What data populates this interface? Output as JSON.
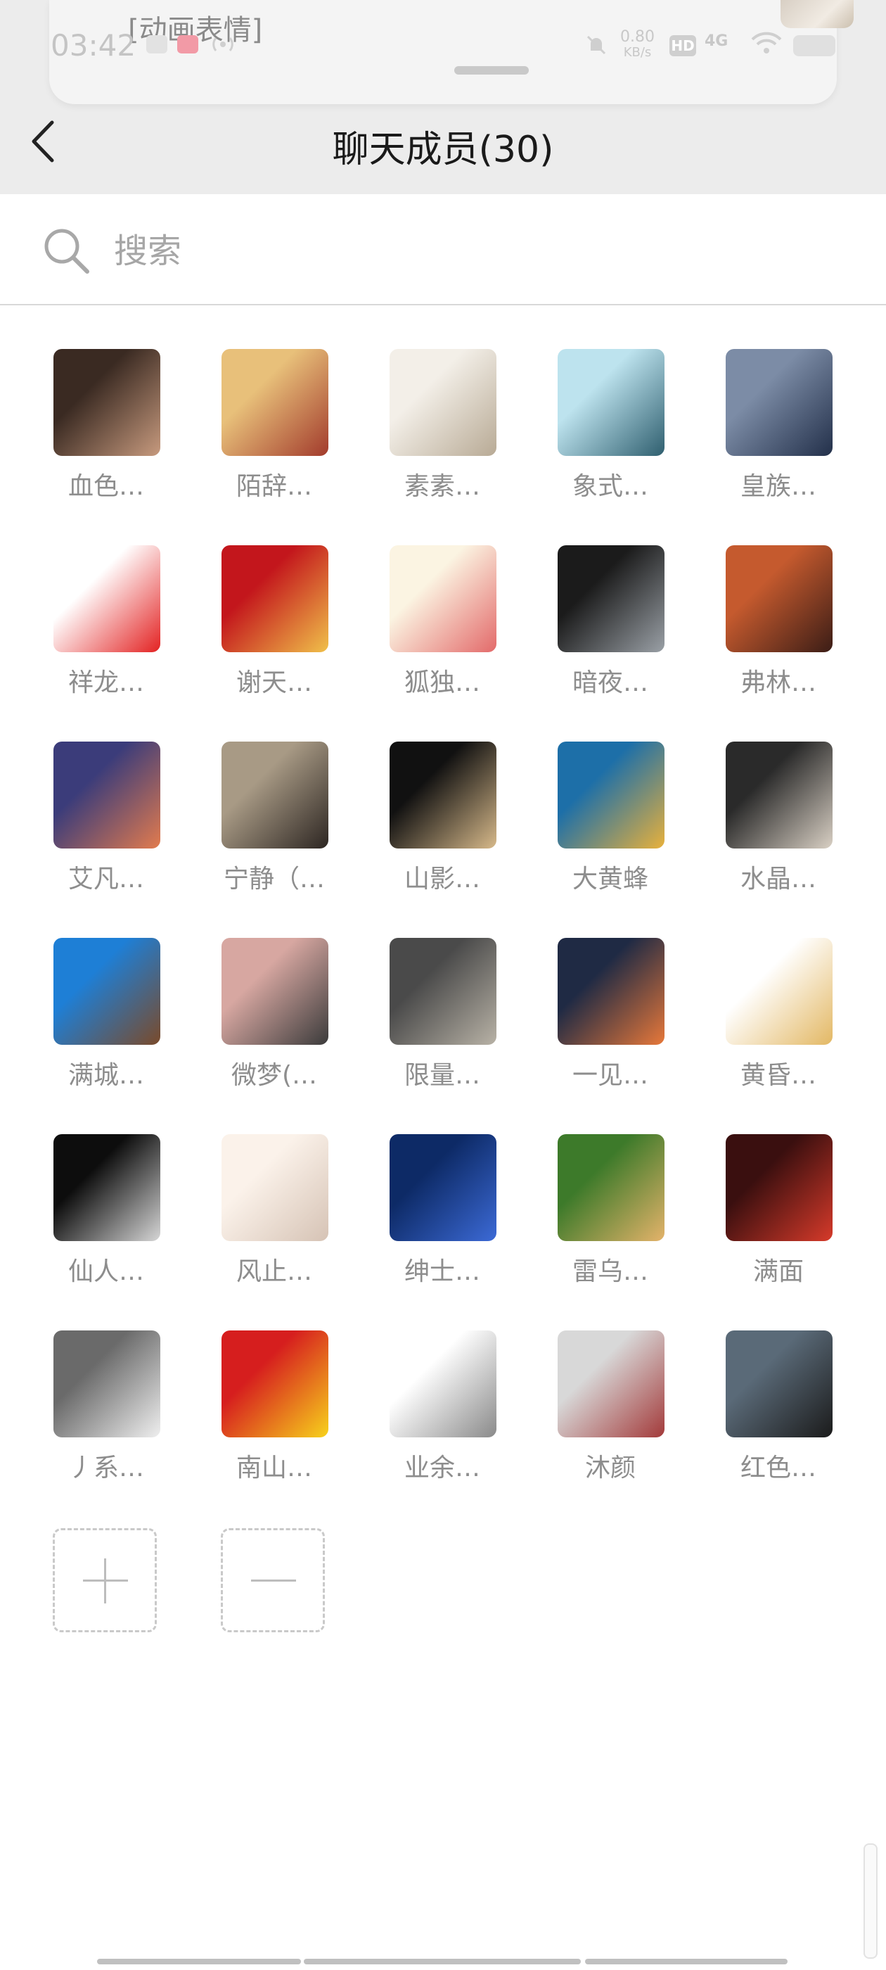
{
  "notification": {
    "text": "[动画表情]"
  },
  "status_bar": {
    "time": "03:42",
    "speed_value": "0.80",
    "speed_unit": "KB/s",
    "hd": "HD",
    "network": "4G"
  },
  "header": {
    "title": "聊天成员(30)"
  },
  "search": {
    "placeholder": "搜索"
  },
  "members": [
    {
      "name": "血色…",
      "colors": [
        "#3a2a22",
        "#c79a7e"
      ]
    },
    {
      "name": "陌辞…",
      "colors": [
        "#e8c07a",
        "#a23b2c"
      ]
    },
    {
      "name": "素素…",
      "colors": [
        "#f3efe8",
        "#b8aa95"
      ]
    },
    {
      "name": "象式…",
      "colors": [
        "#bde3ee",
        "#2f5f6f"
      ]
    },
    {
      "name": "皇族…",
      "colors": [
        "#7c8ca6",
        "#23304a"
      ]
    },
    {
      "name": "祥龙…",
      "colors": [
        "#ffffff",
        "#e32222"
      ]
    },
    {
      "name": "谢天…",
      "colors": [
        "#c3161c",
        "#f0c04a"
      ]
    },
    {
      "name": "狐独…",
      "colors": [
        "#fbf4e2",
        "#e36a6a"
      ]
    },
    {
      "name": "暗夜…",
      "colors": [
        "#1b1b1b",
        "#9aa0a6"
      ]
    },
    {
      "name": "弗林…",
      "colors": [
        "#c55a2e",
        "#3b1d16"
      ]
    },
    {
      "name": "艾凡…",
      "colors": [
        "#3b3c7a",
        "#e27b4e"
      ]
    },
    {
      "name": "宁静（…",
      "colors": [
        "#a89a85",
        "#2d2622"
      ]
    },
    {
      "name": "山影…",
      "colors": [
        "#111111",
        "#d7b98a"
      ]
    },
    {
      "name": "大黄蜂",
      "colors": [
        "#1d6fa8",
        "#e8b13c"
      ]
    },
    {
      "name": "水晶…",
      "colors": [
        "#2a2a2a",
        "#d9d0c4"
      ]
    },
    {
      "name": "满城…",
      "colors": [
        "#1e7fd6",
        "#7a4a2a"
      ]
    },
    {
      "name": "微梦(…",
      "colors": [
        "#d7a7a1",
        "#3b3b3b"
      ]
    },
    {
      "name": "限量…",
      "colors": [
        "#4a4a4a",
        "#b8b2a6"
      ]
    },
    {
      "name": "一见…",
      "colors": [
        "#1f2a44",
        "#e7783a"
      ]
    },
    {
      "name": "黄昏…",
      "colors": [
        "#ffffff",
        "#e3b864"
      ]
    },
    {
      "name": "仙人…",
      "colors": [
        "#0d0d0d",
        "#d6d6d6"
      ]
    },
    {
      "name": "风止…",
      "colors": [
        "#fbf2ea",
        "#d6c3b5"
      ]
    },
    {
      "name": "绅士…",
      "colors": [
        "#0d2a66",
        "#3c6ad6"
      ]
    },
    {
      "name": "雷乌…",
      "colors": [
        "#3d7a2a",
        "#e4b36a"
      ]
    },
    {
      "name": "满面",
      "colors": [
        "#3a0f0f",
        "#d63a2a"
      ]
    },
    {
      "name": "丿系…",
      "colors": [
        "#6a6a6a",
        "#efefef"
      ]
    },
    {
      "name": "南山…",
      "colors": [
        "#d61e1e",
        "#f7d21c"
      ]
    },
    {
      "name": "业余…",
      "colors": [
        "#ffffff",
        "#8a8a8a"
      ]
    },
    {
      "name": "沐颜",
      "colors": [
        "#d8d8d8",
        "#a33a3a"
      ]
    },
    {
      "name": "红色…",
      "colors": [
        "#5a6a78",
        "#1b1b1b"
      ]
    }
  ],
  "actions": {
    "add": "add",
    "remove": "remove"
  }
}
